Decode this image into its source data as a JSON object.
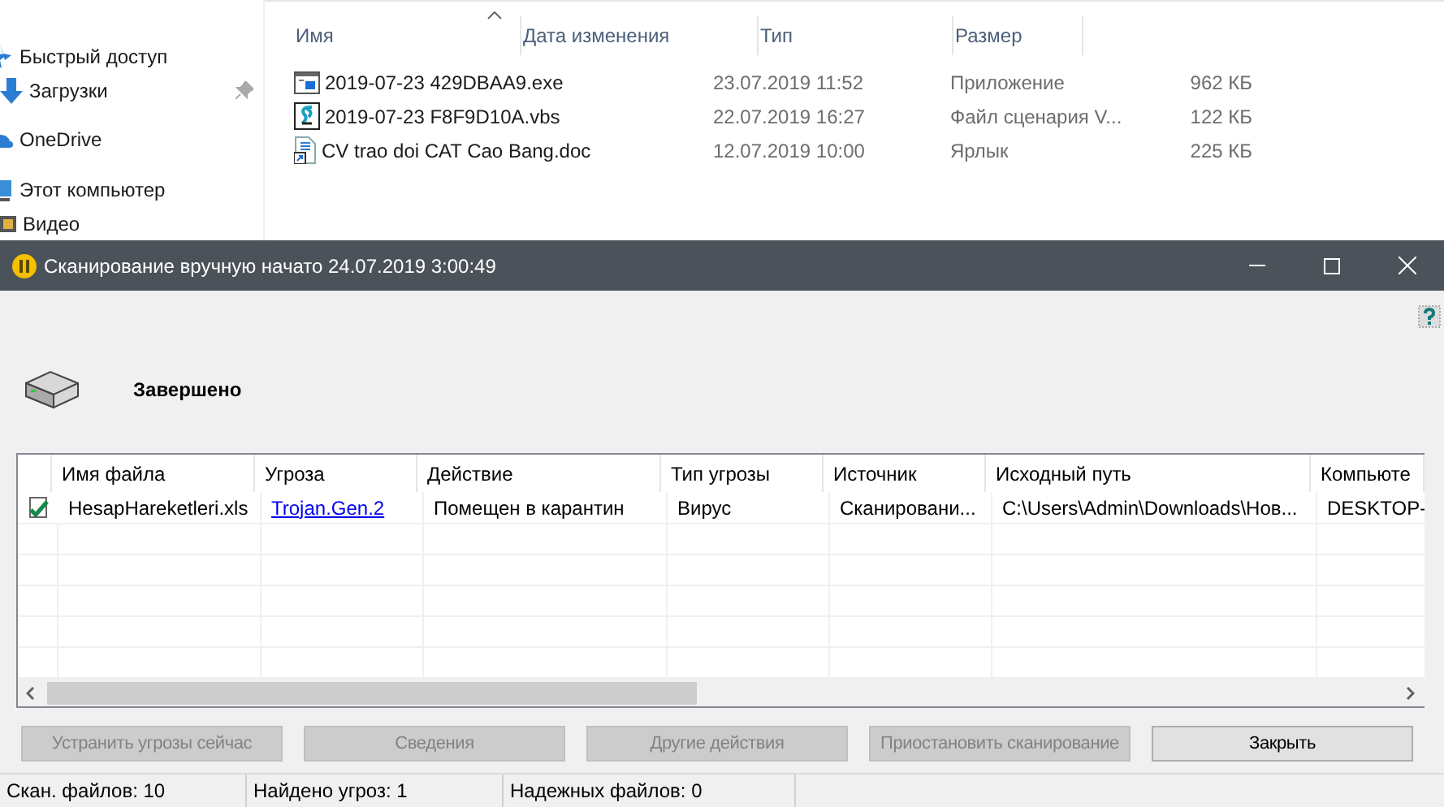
{
  "explorer": {
    "nav": [
      {
        "label": "Быстрый доступ",
        "kind": "star"
      },
      {
        "label": "Загрузки",
        "kind": "download",
        "pinned": true
      },
      {
        "label": "OneDrive",
        "kind": "cloud"
      },
      {
        "label": "Этот компьютер",
        "kind": "pc"
      },
      {
        "label": "Видео",
        "kind": "video"
      }
    ],
    "columns": [
      "Имя",
      "Дата изменения",
      "Тип",
      "Размер"
    ],
    "files": [
      {
        "name": "2019-07-23 429DBAA9.exe",
        "date": "23.07.2019 11:52",
        "type": "Приложение",
        "size": "962 КБ",
        "kind": "exe"
      },
      {
        "name": "2019-07-23 F8F9D10A.vbs",
        "date": "22.07.2019 16:27",
        "type": "Файл сценария V...",
        "size": "122 КБ",
        "kind": "script"
      },
      {
        "name": "CV trao doi CAT Cao Bang.doc",
        "date": "12.07.2019 10:00",
        "type": "Ярлык",
        "size": "225 КБ",
        "kind": "shortcut"
      }
    ]
  },
  "scan_window": {
    "title": "Сканирование вручную начато 24.07.2019 3:00:49",
    "status": "Завершено",
    "table": {
      "columns": [
        "Имя файла",
        "Угроза",
        "Действие",
        "Тип угрозы",
        "Источник",
        "Исходный путь",
        "Компьюте"
      ],
      "rows": [
        {
          "checked": true,
          "cells": [
            {
              "text": "HesapHareketleri.xls",
              "kind": "text"
            },
            {
              "text": "Trojan.Gen.2",
              "kind": "link"
            },
            {
              "text": "Помещен в карантин",
              "kind": "text"
            },
            {
              "text": "Вирус",
              "kind": "text"
            },
            {
              "text": "Сканировани...",
              "kind": "text"
            },
            {
              "text": "C:\\Users\\Admin\\Downloads\\Нов...",
              "kind": "text"
            },
            {
              "text": "DESKTOP-",
              "kind": "text"
            }
          ]
        }
      ]
    },
    "buttons": [
      {
        "label": "Устранить угрозы сейчас",
        "disabled": true
      },
      {
        "label": "Сведения",
        "disabled": true
      },
      {
        "label": "Другие действия",
        "disabled": true
      },
      {
        "label": "Приостановить сканирование",
        "disabled": true
      },
      {
        "label": "Закрыть",
        "disabled": false
      }
    ],
    "status_bar": [
      "Скан. файлов: 10",
      "Найдено угроз: 1",
      "Надежных файлов: 0"
    ]
  }
}
